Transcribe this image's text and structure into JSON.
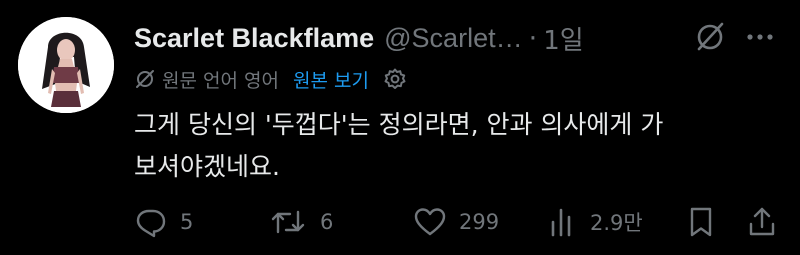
{
  "post": {
    "author": {
      "display_name": "Scarlet Blackflame",
      "handle": "@Scarlet…",
      "separator": "·",
      "time": "1일"
    },
    "translation": {
      "icon": "translate-icon",
      "language_note": "원문 언어 영어",
      "show_original_label": "원본 보기",
      "settings_icon": "gear-icon"
    },
    "text_lines": [
      "그게 당신의 '두껍다'는 정의라면, 안과 의사에게 가",
      "보셔야겠네요."
    ],
    "actions": {
      "reply": {
        "icon": "reply-icon",
        "count": "5"
      },
      "retweet": {
        "icon": "retweet-icon",
        "count": "6"
      },
      "like": {
        "icon": "heart-icon",
        "count": "299"
      },
      "views": {
        "icon": "views-icon",
        "count": "2.9만"
      },
      "bookmark": {
        "icon": "bookmark-icon"
      },
      "share": {
        "icon": "share-icon"
      }
    }
  },
  "colors": {
    "background": "#000000",
    "primary_text": "#e7e9ea",
    "secondary_text": "#71767b",
    "link": "#1d9bf0"
  }
}
